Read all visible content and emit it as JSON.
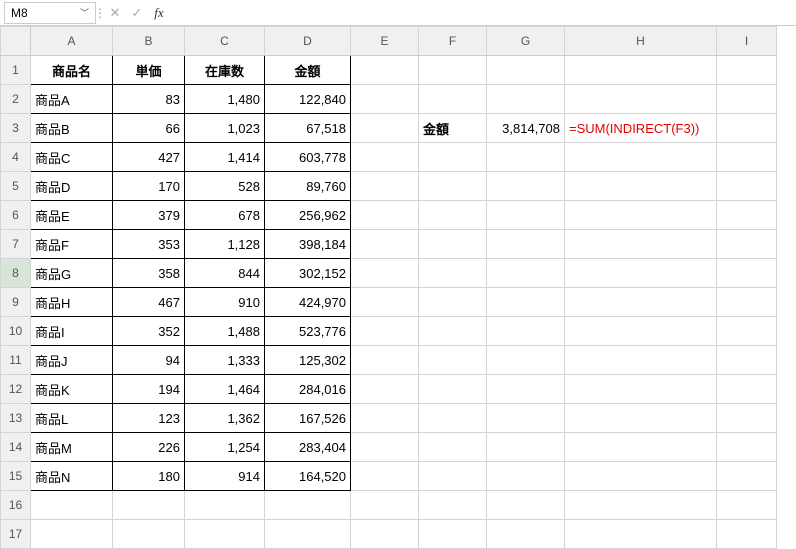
{
  "nameBox": "M8",
  "formulaBarValue": "",
  "columns": [
    "A",
    "B",
    "C",
    "D",
    "E",
    "F",
    "G",
    "H",
    "I"
  ],
  "headers": {
    "a": "商品名",
    "b": "単価",
    "c": "在庫数",
    "d": "金額"
  },
  "rows": [
    {
      "name": "商品A",
      "price": "83",
      "stock": "1,480",
      "amount": "122,840"
    },
    {
      "name": "商品B",
      "price": "66",
      "stock": "1,023",
      "amount": "67,518"
    },
    {
      "name": "商品C",
      "price": "427",
      "stock": "1,414",
      "amount": "603,778"
    },
    {
      "name": "商品D",
      "price": "170",
      "stock": "528",
      "amount": "89,760"
    },
    {
      "name": "商品E",
      "price": "379",
      "stock": "678",
      "amount": "256,962"
    },
    {
      "name": "商品F",
      "price": "353",
      "stock": "1,128",
      "amount": "398,184"
    },
    {
      "name": "商品G",
      "price": "358",
      "stock": "844",
      "amount": "302,152"
    },
    {
      "name": "商品H",
      "price": "467",
      "stock": "910",
      "amount": "424,970"
    },
    {
      "name": "商品I",
      "price": "352",
      "stock": "1,488",
      "amount": "523,776"
    },
    {
      "name": "商品J",
      "price": "94",
      "stock": "1,333",
      "amount": "125,302"
    },
    {
      "name": "商品K",
      "price": "194",
      "stock": "1,464",
      "amount": "284,016"
    },
    {
      "name": "商品L",
      "price": "123",
      "stock": "1,362",
      "amount": "167,526"
    },
    {
      "name": "商品M",
      "price": "226",
      "stock": "1,254",
      "amount": "283,404"
    },
    {
      "name": "商品N",
      "price": "180",
      "stock": "914",
      "amount": "164,520"
    }
  ],
  "side": {
    "f3": "金額",
    "g3": "3,814,708",
    "h3": "=SUM(INDIRECT(F3))"
  },
  "icons": {
    "chevDown": "﹀",
    "sep": "⋮",
    "cancel": "✕",
    "confirm": "✓",
    "fx": "fx"
  },
  "activeRow": 8
}
